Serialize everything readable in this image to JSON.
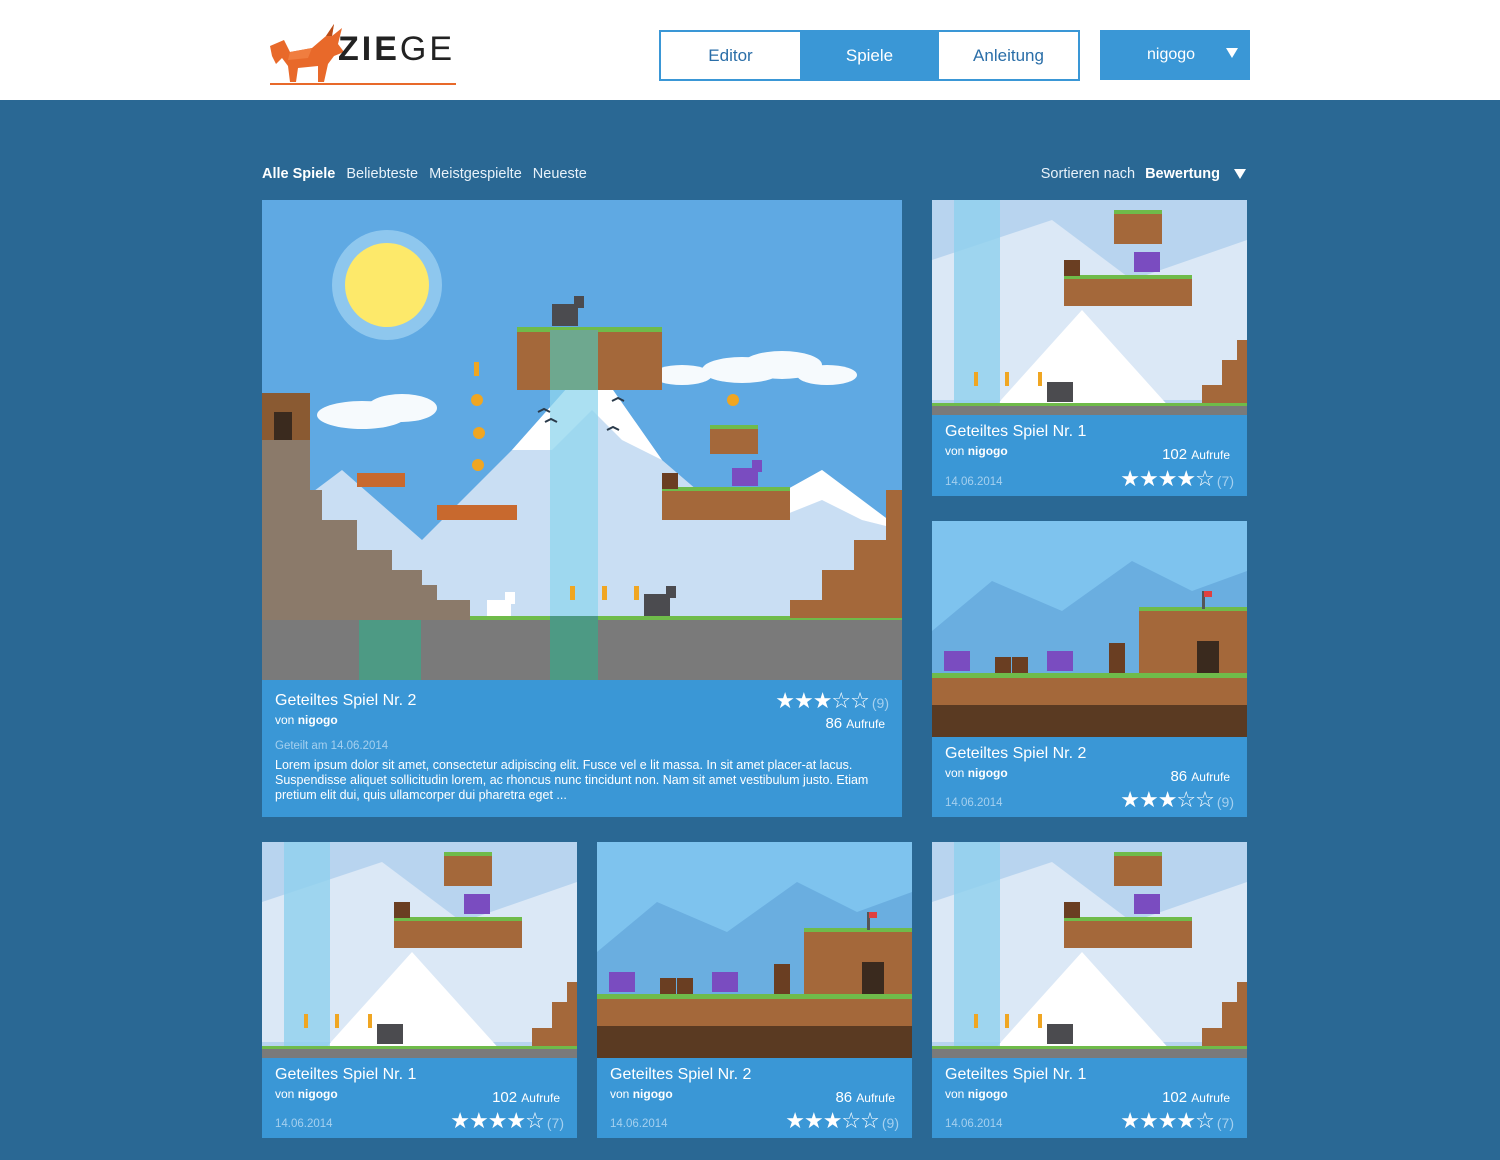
{
  "brand": {
    "name_bold": "ZIE",
    "name_light": "GE"
  },
  "nav": {
    "tabs": [
      "Editor",
      "Spiele",
      "Anleitung"
    ],
    "active": "Spiele"
  },
  "user": {
    "name": "nigogo"
  },
  "filters": {
    "items": [
      "Alle Spiele",
      "Beliebteste",
      "Meistgespielte",
      "Neueste"
    ],
    "active": "Alle Spiele"
  },
  "sort": {
    "label": "Sortieren nach",
    "value": "Bewertung"
  },
  "featured": {
    "title": "Geteiltes Spiel Nr. 2",
    "author_prefix": "von",
    "author": "nigogo",
    "stars": "★★★☆☆",
    "rating_count": "(9)",
    "views": "86",
    "views_label": "Aufrufe",
    "shared_date": "Geteilt am 14.06.2014",
    "description": "Lorem ipsum dolor sit amet, consectetur adipiscing elit. Fusce vel e lit massa. In sit amet placer-at lacus. Suspendisse aliquet sollicitudin lorem, ac rhoncus nunc tincidunt non. Nam sit amet vestibulum justo. Etiam pretium elit dui, quis ullamcorper dui pharetra eget ..."
  },
  "cards": [
    {
      "title": "Geteiltes Spiel Nr. 1",
      "author_prefix": "von",
      "author": "nigogo",
      "views": "102",
      "views_label": "Aufrufe",
      "date": "14.06.2014",
      "stars": "★★★★☆",
      "rating_count": "(7)"
    },
    {
      "title": "Geteiltes Spiel Nr. 2",
      "author_prefix": "von",
      "author": "nigogo",
      "views": "86",
      "views_label": "Aufrufe",
      "date": "14.06.2014",
      "stars": "★★★☆☆",
      "rating_count": "(9)"
    },
    {
      "title": "Geteiltes Spiel Nr. 1",
      "author_prefix": "von",
      "author": "nigogo",
      "views": "102",
      "views_label": "Aufrufe",
      "date": "14.06.2014",
      "stars": "★★★★☆",
      "rating_count": "(7)"
    },
    {
      "title": "Geteiltes Spiel Nr. 2",
      "author_prefix": "von",
      "author": "nigogo",
      "views": "86",
      "views_label": "Aufrufe",
      "date": "14.06.2014",
      "stars": "★★★☆☆",
      "rating_count": "(9)"
    },
    {
      "title": "Geteiltes Spiel Nr. 1",
      "author_prefix": "von",
      "author": "nigogo",
      "views": "102",
      "views_label": "Aufrufe",
      "date": "14.06.2014",
      "stars": "★★★★☆",
      "rating_count": "(7)"
    }
  ],
  "colors": {
    "background": "#2a6894",
    "accent": "#3a97d6",
    "brand_orange": "#e8692a"
  }
}
